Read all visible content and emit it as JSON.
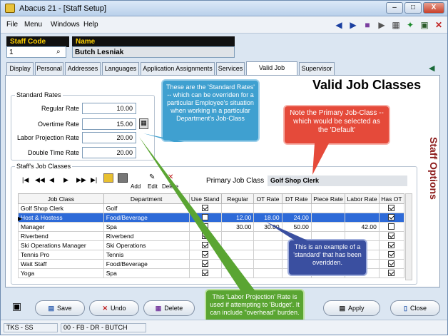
{
  "window": {
    "title": "Abacus 21 - [Staff Setup]",
    "min": "–",
    "max": "□",
    "close": "X"
  },
  "menu": {
    "items": [
      "File",
      "Menu",
      "Windows",
      "Help"
    ]
  },
  "header": {
    "staff_code_label": "Staff Code",
    "staff_code_value": "1",
    "name_label": "Name",
    "name_value": "Butch  Lesniak"
  },
  "tabs": [
    "Display",
    "Personal",
    "Addresses",
    "Languages",
    "Application Assignments",
    "Services",
    "Valid Job Classes",
    "Supervisor"
  ],
  "page_title": "Valid Job Classes",
  "side_title": "Staff Options",
  "standard_rates": {
    "title": "Standard Rates",
    "rows": [
      {
        "label": "Regular Rate",
        "value": "10.00"
      },
      {
        "label": "Overtime Rate",
        "value": "15.00"
      },
      {
        "label": "Labor Projection Rate",
        "value": "20.00"
      },
      {
        "label": "Double Time Rate",
        "value": "20.00"
      }
    ]
  },
  "job_classes": {
    "title": "Staff's Job Classes",
    "nav": [
      "|◀",
      "◀◀",
      "◀",
      "▶",
      "▶▶",
      "▶|"
    ],
    "add_label": "Add",
    "edit_label": "Edit",
    "delete_label": "Delete",
    "primary_label": "Primary Job Class",
    "primary_value": "Golf Shop Clerk",
    "columns": [
      "Job Class",
      "Department",
      "Use Stand",
      "Regular",
      "OT Rate",
      "DT Rate",
      "Piece Rate",
      "Labor Rate",
      "Has OT"
    ],
    "rows": [
      {
        "job": "Golf Shop Clerk",
        "dept": "Golf",
        "use": true,
        "reg": "",
        "ot": "",
        "dt": "",
        "piece": "",
        "labor": "",
        "hasot": true,
        "selected": false
      },
      {
        "job": "Host & Hostess",
        "dept": "Food/Beverage",
        "use": false,
        "reg": "12.00",
        "ot": "18.00",
        "dt": "24.00",
        "piece": "",
        "labor": "",
        "hasot": true,
        "selected": true
      },
      {
        "job": "Manager",
        "dept": "Spa",
        "use": false,
        "reg": "30.00",
        "ot": "30.00",
        "dt": "50.00",
        "piece": "",
        "labor": "42.00",
        "hasot": false,
        "selected": false
      },
      {
        "job": "Riverbend",
        "dept": "Riverbend",
        "use": true,
        "reg": "",
        "ot": "",
        "dt": "",
        "piece": "",
        "labor": "",
        "hasot": true,
        "selected": false
      },
      {
        "job": "Ski Operations Manager",
        "dept": "Ski Operations",
        "use": true,
        "reg": "",
        "ot": "",
        "dt": "",
        "piece": "",
        "labor": "",
        "hasot": true,
        "selected": false
      },
      {
        "job": "Tennis Pro",
        "dept": "Tennis",
        "use": true,
        "reg": "",
        "ot": "",
        "dt": "",
        "piece": "",
        "labor": "",
        "hasot": true,
        "selected": false
      },
      {
        "job": "Wait Staff",
        "dept": "Food/Beverage",
        "use": true,
        "reg": "",
        "ot": "",
        "dt": "",
        "piece": "",
        "labor": "",
        "hasot": true,
        "selected": false
      },
      {
        "job": "Yoga",
        "dept": "Spa",
        "use": true,
        "reg": "",
        "ot": "",
        "dt": "",
        "piece": "",
        "labor": "",
        "hasot": true,
        "selected": false
      }
    ]
  },
  "callouts": {
    "standard": "These are the 'Standard Rates' -- which can be overriden for a particular Employee's situation when working in a particular Department's Job-Class",
    "primary": "Note the Primary Job-Class -- which would be selected as the 'Default'",
    "override": "This is an example of a 'standard' that has been overidden.",
    "labor": "This 'Labor Projection' Rate is used if attempting to 'Budget'. It can include \"overhead\" burden."
  },
  "buttons": {
    "save": "Save",
    "undo": "Undo",
    "delete": "Delete",
    "apply": "Apply",
    "close": "Close"
  },
  "status": {
    "left": "TKS - SS",
    "right": "00 - FB - DR - BUTCH"
  },
  "colors": {
    "callout_blue": "#3fa0d0",
    "callout_red": "#e54a3a",
    "callout_navy": "#3a4fa0",
    "callout_green": "#5aa532",
    "accent_title": "#8b1a1a"
  }
}
